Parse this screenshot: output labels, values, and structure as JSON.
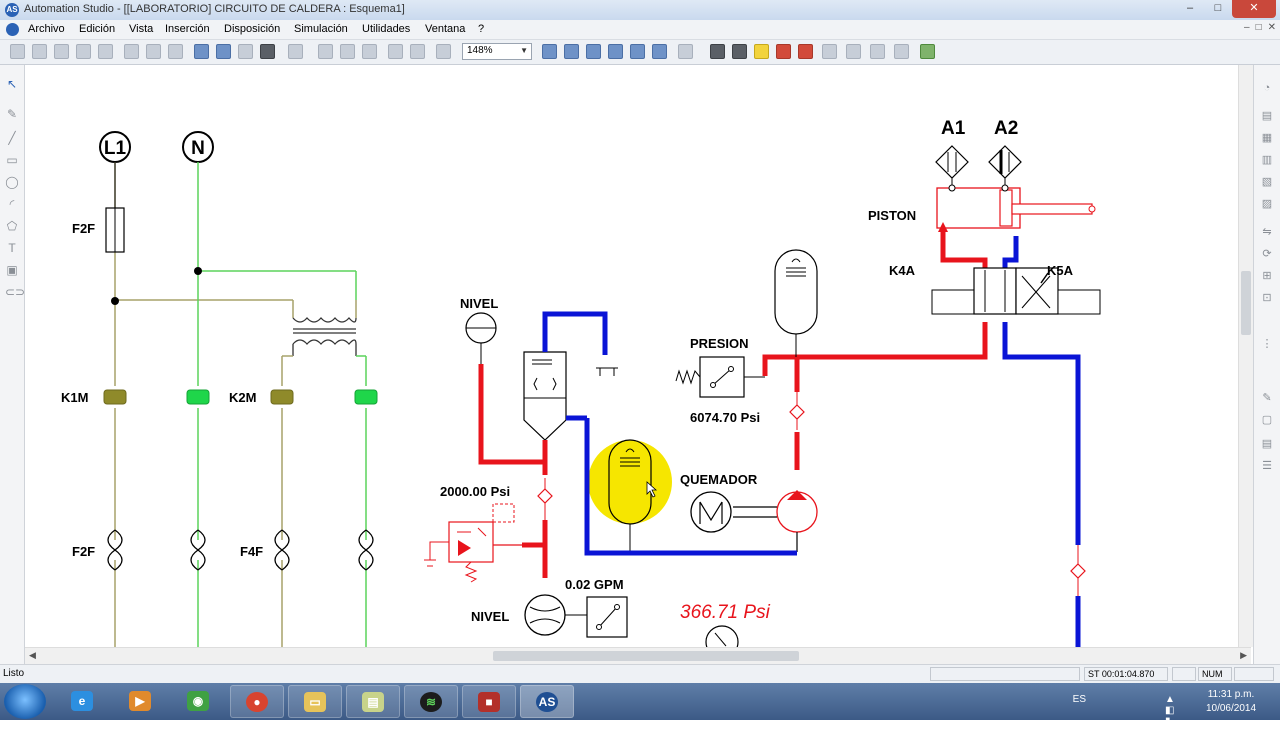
{
  "window": {
    "title": "Automation Studio - [[LABORATORIO] CIRCUITO DE CALDERA : Esquema1]",
    "app_icon": "AS",
    "controls": {
      "minimize": "–",
      "maximize": "□",
      "close": "✕"
    }
  },
  "menu": {
    "items": [
      "Archivo",
      "Edición",
      "Vista",
      "Inserción",
      "Disposición",
      "Simulación",
      "Utilidades",
      "Ventana",
      "?"
    ],
    "mdi_controls": [
      "–",
      "□",
      "✕"
    ]
  },
  "toolbar": {
    "zoom_value": "148%",
    "icons": [
      "new-icon",
      "open-icon",
      "save-icon",
      "print-icon",
      "preview-icon",
      "zoom-in-icon",
      "zoom-out-icon",
      "zoom-window-icon",
      "zoom-fit-icon",
      "pan-icon",
      "step-icon",
      "pause-icon",
      "stop-icon",
      "record-icon",
      "measure-icon"
    ]
  },
  "schematic": {
    "electrical": {
      "L1": "L1",
      "N": "N",
      "F2F_top": "F2F",
      "K1M": "K1M",
      "K2M": "K2M",
      "F2F_bottom": "F2F",
      "F4F": "F4F"
    },
    "hydraulic": {
      "A1": "A1",
      "A2": "A2",
      "piston": "PISTON",
      "k4a": "K4A",
      "k5a": "K5A",
      "nivel_top": "NIVEL",
      "presion": "PRESION",
      "pressure_reading": "6074.70 Psi",
      "quemador": "QUEMADOR",
      "relief_reading": "2000.00 Psi",
      "flow_reading": "0.02 GPM",
      "nivel_bottom": "NIVEL",
      "gauge_reading": "366.71 Psi"
    },
    "colors": {
      "pressure_line": "#e8141c",
      "return_line": "#0a14d6",
      "energized_wire": "#5bd35b",
      "contact_active": "#1fd64a",
      "contact_idle": "#8f8a2a",
      "highlight": "#f6e600"
    }
  },
  "status": {
    "left": "Listo",
    "timer": "ST 00:01:04.870",
    "num": "NUM"
  },
  "taskbar": {
    "apps": [
      "internet-explorer-icon",
      "media-player-icon",
      "network-icon",
      "chrome-icon",
      "file-explorer-icon",
      "notes-icon",
      "spotify-icon",
      "player-icon",
      "automation-studio-icon"
    ],
    "as_label": "AS",
    "language": "ES",
    "time": "11:31 p.m.",
    "date": "10/06/2014"
  }
}
